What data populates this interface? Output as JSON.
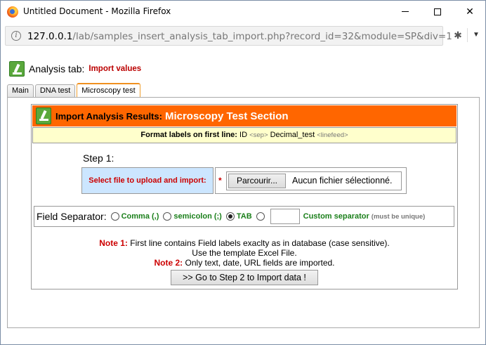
{
  "window": {
    "title": "Untitled Document - Mozilla Firefox",
    "minimize_glyph": "—",
    "close_glyph": "✕"
  },
  "address_bar": {
    "host": "127.0.0.1",
    "path": "/lab/samples_insert_analysis_tab_import.php?record_id=32&module=SP&div=1"
  },
  "page": {
    "heading_label": "Analysis tab:",
    "heading_sub": "Import values"
  },
  "tabs": [
    {
      "label": "Main",
      "active": false
    },
    {
      "label": "DNA test",
      "active": false
    },
    {
      "label": "Microscopy test",
      "active": true
    }
  ],
  "section": {
    "title_prefix": "Import Analysis Results:",
    "title_main": "Microscopy Test Section",
    "format_label": "Format labels on first line:",
    "format_id": "ID",
    "format_sep": "<sep>",
    "format_field": "Decimal_test",
    "format_linefeed": "<linefeed>"
  },
  "upload": {
    "step_label": "Step 1:",
    "file_label": "Select file to upload and import:",
    "required_mark": "*",
    "browse_label": "Parcourir...",
    "no_file_text": "Aucun fichier sélectionné."
  },
  "separator": {
    "label": "Field Separator:",
    "options": [
      {
        "label": "Comma (,)",
        "selected": false
      },
      {
        "label": "semicolon (;)",
        "selected": false
      },
      {
        "label": "TAB",
        "selected": true
      },
      {
        "label": "Custom separator",
        "selected": false
      }
    ],
    "custom_value": "",
    "custom_hint": "(must be unique)"
  },
  "notes": {
    "note1_label": "Note 1:",
    "note1_text": "First line contains Field labels exaclty as in database (case sensitive).",
    "note1_line2": "Use the template Excel File.",
    "note2_label": "Note 2:",
    "note2_text": "Only text, date, URL fields are imported."
  },
  "actions": {
    "go_step2": ">> Go to Step 2 to Import data !"
  },
  "colors": {
    "section_header": "#ff6600",
    "format_bg": "#ffffcc",
    "file_label_bg": "#cce6ff",
    "option_green": "#1a7f1a",
    "note_red": "#cc0000"
  }
}
